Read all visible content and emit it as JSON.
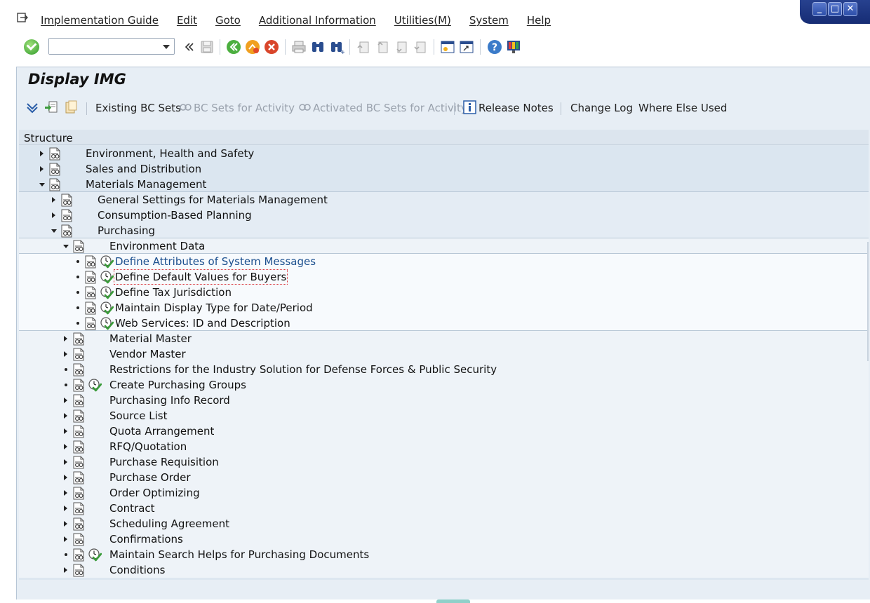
{
  "menu": {
    "items": [
      "Implementation Guide",
      "Edit",
      "Goto",
      "Additional Information",
      "Utilities(M)",
      "System",
      "Help"
    ]
  },
  "window_controls": {
    "minimize": "_",
    "maximize": "□",
    "close": "✕"
  },
  "command_field": {
    "value": ""
  },
  "page_title": "Display IMG",
  "app_toolbar": {
    "existing_bc_sets": "Existing BC Sets",
    "bc_sets_for_activity": "BC Sets for Activity",
    "activated_bc_sets": "Activated BC Sets for Activity",
    "release_notes": "Release Notes",
    "change_log": "Change Log",
    "where_else_used": "Where Else Used"
  },
  "tree": {
    "header": "Structure",
    "rows": [
      {
        "label": "Environment, Health and Safety",
        "level": 0,
        "state": "collapsed"
      },
      {
        "label": "Sales and Distribution",
        "level": 0,
        "state": "collapsed"
      },
      {
        "label": "Materials Management",
        "level": 0,
        "state": "expanded"
      },
      {
        "label": "General Settings for Materials Management",
        "level": 1,
        "state": "collapsed"
      },
      {
        "label": "Consumption-Based Planning",
        "level": 1,
        "state": "collapsed"
      },
      {
        "label": "Purchasing",
        "level": 1,
        "state": "expanded"
      },
      {
        "label": "Environment Data",
        "level": 2,
        "state": "expanded"
      },
      {
        "label": "Define Attributes of System Messages",
        "level": 3,
        "state": "leaf",
        "exec": true
      },
      {
        "label": "Define Default Values for Buyers",
        "level": 3,
        "state": "leaf",
        "exec": true
      },
      {
        "label": "Define Tax Jurisdiction",
        "level": 3,
        "state": "leaf",
        "exec": true
      },
      {
        "label": "Maintain Display Type for Date/Period",
        "level": 3,
        "state": "leaf",
        "exec": true
      },
      {
        "label": "Web Services: ID and Description",
        "level": 3,
        "state": "leaf",
        "exec": true
      },
      {
        "label": "Material Master",
        "level": 2,
        "state": "collapsed"
      },
      {
        "label": "Vendor Master",
        "level": 2,
        "state": "collapsed"
      },
      {
        "label": "Restrictions for the Industry Solution for Defense Forces & Public Security",
        "level": 2,
        "state": "leaf"
      },
      {
        "label": "Create Purchasing Groups",
        "level": 2,
        "state": "leaf",
        "exec": true
      },
      {
        "label": "Purchasing Info Record",
        "level": 2,
        "state": "collapsed"
      },
      {
        "label": "Source List",
        "level": 2,
        "state": "collapsed"
      },
      {
        "label": "Quota Arrangement",
        "level": 2,
        "state": "collapsed"
      },
      {
        "label": "RFQ/Quotation",
        "level": 2,
        "state": "collapsed"
      },
      {
        "label": "Purchase Requisition",
        "level": 2,
        "state": "collapsed"
      },
      {
        "label": "Purchase Order",
        "level": 2,
        "state": "collapsed"
      },
      {
        "label": "Order Optimizing",
        "level": 2,
        "state": "collapsed"
      },
      {
        "label": "Contract",
        "level": 2,
        "state": "collapsed"
      },
      {
        "label": "Scheduling Agreement",
        "level": 2,
        "state": "collapsed"
      },
      {
        "label": "Confirmations",
        "level": 2,
        "state": "collapsed"
      },
      {
        "label": "Maintain Search Helps for Purchasing Documents",
        "level": 2,
        "state": "leaf",
        "exec": true
      },
      {
        "label": "Conditions",
        "level": 2,
        "state": "collapsed"
      }
    ]
  },
  "colors": {
    "panel_bg": "#e7eef5",
    "tree_bg": "#dde7f0",
    "link_blue": "#1b4f8e",
    "window_ctrl_blue": "#1f3a88",
    "exec_green": "#3a9b3a"
  }
}
